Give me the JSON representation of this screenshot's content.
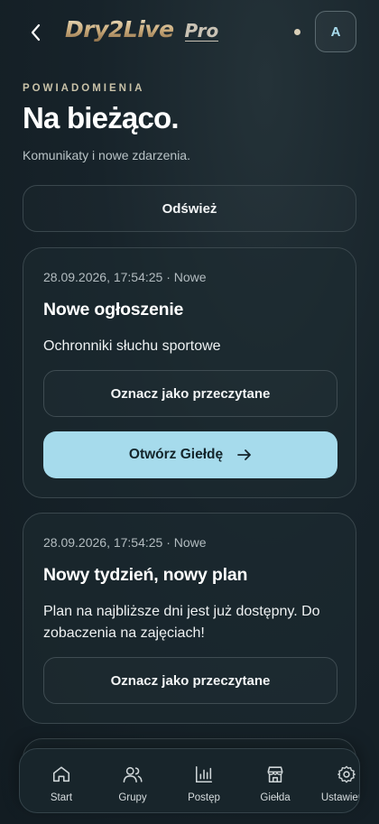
{
  "header": {
    "logo_main": "Dry2Live",
    "logo_badge": "Pro",
    "avatar_initial": "A"
  },
  "page": {
    "eyebrow": "POWIADOMIENIA",
    "title": "Na bieżąco.",
    "subtitle": "Komunikaty i nowe zdarzenia.",
    "refresh_label": "Odśwież"
  },
  "notifications": [
    {
      "meta": "28.09.2026, 17:54:25 · Nowe",
      "title": "Nowe ogłoszenie",
      "body": "Ochronniki słuchu sportowe",
      "mark_label": "Oznacz jako przeczytane",
      "open_label": "Otwórz Giełdę"
    },
    {
      "meta": "28.09.2026, 17:54:25 · Nowe",
      "title": "Nowy tydzień, nowy plan",
      "body": "Plan na najbliższe dni jest już dostępny. Do zobaczenia na zajęciach!",
      "mark_label": "Oznacz jako przeczytane"
    }
  ],
  "nav": {
    "items": [
      {
        "label": "Start",
        "icon": "home-icon"
      },
      {
        "label": "Grupy",
        "icon": "users-icon"
      },
      {
        "label": "Postęp",
        "icon": "bar-chart-icon"
      },
      {
        "label": "Giełda",
        "icon": "store-icon"
      },
      {
        "label": "Ustawienia",
        "icon": "gear-icon"
      }
    ]
  },
  "colors": {
    "background": "#17232a",
    "accent": "#a6dbec",
    "logo_gold": "#c8a878",
    "card_border": "#3a474d"
  }
}
